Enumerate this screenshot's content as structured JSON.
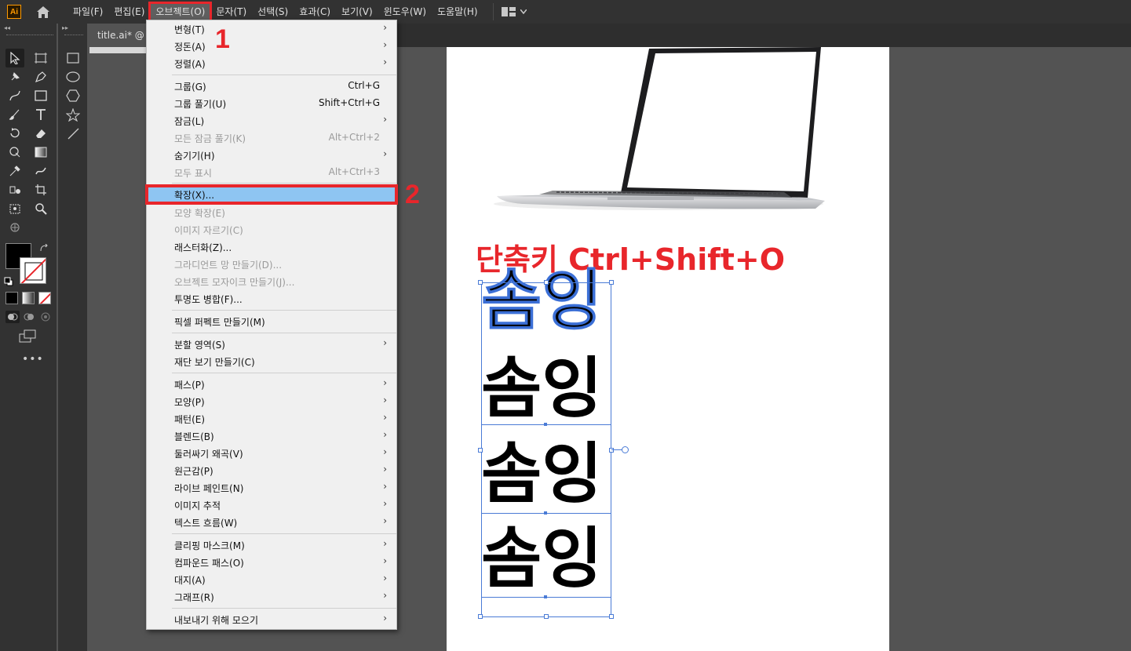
{
  "app": {
    "logo_text": "Ai",
    "accent": "#ff9a00"
  },
  "menubar": {
    "items": [
      "파일(F)",
      "편집(E)",
      "오브젝트(O)",
      "문자(T)",
      "선택(S)",
      "효과(C)",
      "보기(V)",
      "윈도우(W)",
      "도움말(H)"
    ],
    "active_index": 2
  },
  "document": {
    "tab_title": "title.ai* @ "
  },
  "dropdown": {
    "items": [
      {
        "label": "변형(T)",
        "shortcut": "",
        "submenu": true,
        "disabled": false
      },
      {
        "label": "정돈(A)",
        "shortcut": "",
        "submenu": true,
        "disabled": false
      },
      {
        "label": "정렬(A)",
        "shortcut": "",
        "submenu": true,
        "disabled": false
      },
      {
        "label": "그룹(G)",
        "shortcut": "Ctrl+G",
        "submenu": false,
        "disabled": false
      },
      {
        "label": "그룹 풀기(U)",
        "shortcut": "Shift+Ctrl+G",
        "submenu": false,
        "disabled": false
      },
      {
        "label": "잠금(L)",
        "shortcut": "",
        "submenu": true,
        "disabled": false
      },
      {
        "label": "모든 잠금 풀기(K)",
        "shortcut": "Alt+Ctrl+2",
        "submenu": false,
        "disabled": true
      },
      {
        "label": "숨기기(H)",
        "shortcut": "",
        "submenu": true,
        "disabled": false
      },
      {
        "label": "모두 표시",
        "shortcut": "Alt+Ctrl+3",
        "submenu": false,
        "disabled": true
      },
      {
        "label": "확장(X)...",
        "shortcut": "",
        "submenu": false,
        "disabled": false,
        "highlighted": true
      },
      {
        "label": "모양 확장(E)",
        "shortcut": "",
        "submenu": false,
        "disabled": true
      },
      {
        "label": "이미지 자르기(C)",
        "shortcut": "",
        "submenu": false,
        "disabled": true
      },
      {
        "label": "래스터화(Z)...",
        "shortcut": "",
        "submenu": false,
        "disabled": false
      },
      {
        "label": "그라디언트 망 만들기(D)...",
        "shortcut": "",
        "submenu": false,
        "disabled": true
      },
      {
        "label": "오브젝트 모자이크 만들기(J)...",
        "shortcut": "",
        "submenu": false,
        "disabled": true
      },
      {
        "label": "투명도 병합(F)...",
        "shortcut": "",
        "submenu": false,
        "disabled": false
      },
      {
        "label": "픽셀 퍼펙트 만들기(M)",
        "shortcut": "",
        "submenu": false,
        "disabled": false
      },
      {
        "label": "분할 영역(S)",
        "shortcut": "",
        "submenu": true,
        "disabled": false
      },
      {
        "label": "재단 보기 만들기(C)",
        "shortcut": "",
        "submenu": false,
        "disabled": false
      },
      {
        "label": "패스(P)",
        "shortcut": "",
        "submenu": true,
        "disabled": false
      },
      {
        "label": "모양(P)",
        "shortcut": "",
        "submenu": true,
        "disabled": false
      },
      {
        "label": "패턴(E)",
        "shortcut": "",
        "submenu": true,
        "disabled": false
      },
      {
        "label": "블렌드(B)",
        "shortcut": "",
        "submenu": true,
        "disabled": false
      },
      {
        "label": "둘러싸기 왜곡(V)",
        "shortcut": "",
        "submenu": true,
        "disabled": false
      },
      {
        "label": "원근감(P)",
        "shortcut": "",
        "submenu": true,
        "disabled": false
      },
      {
        "label": "라이브 페인트(N)",
        "shortcut": "",
        "submenu": true,
        "disabled": false
      },
      {
        "label": "이미지 추적",
        "shortcut": "",
        "submenu": true,
        "disabled": false
      },
      {
        "label": "텍스트 흐름(W)",
        "shortcut": "",
        "submenu": true,
        "disabled": false
      },
      {
        "label": "클리핑 마스크(M)",
        "shortcut": "",
        "submenu": true,
        "disabled": false
      },
      {
        "label": "컴파운드 패스(O)",
        "shortcut": "",
        "submenu": true,
        "disabled": false
      },
      {
        "label": "대지(A)",
        "shortcut": "",
        "submenu": true,
        "disabled": false
      },
      {
        "label": "그래프(R)",
        "shortcut": "",
        "submenu": true,
        "disabled": false
      },
      {
        "label": "내보내기 위해 모으기",
        "shortcut": "",
        "submenu": true,
        "disabled": false
      }
    ]
  },
  "annotations": {
    "step1": "1",
    "step2": "2"
  },
  "artboard": {
    "shortcut_text": "단축키 Ctrl+Shift+O",
    "sample_words": [
      "솜잉",
      "솜잉",
      "솜잉",
      "솜잉"
    ]
  },
  "colors": {
    "annotation_red": "#e8262b",
    "highlight_blue": "#8ec5f2",
    "selection_blue": "#4a7bd6"
  }
}
